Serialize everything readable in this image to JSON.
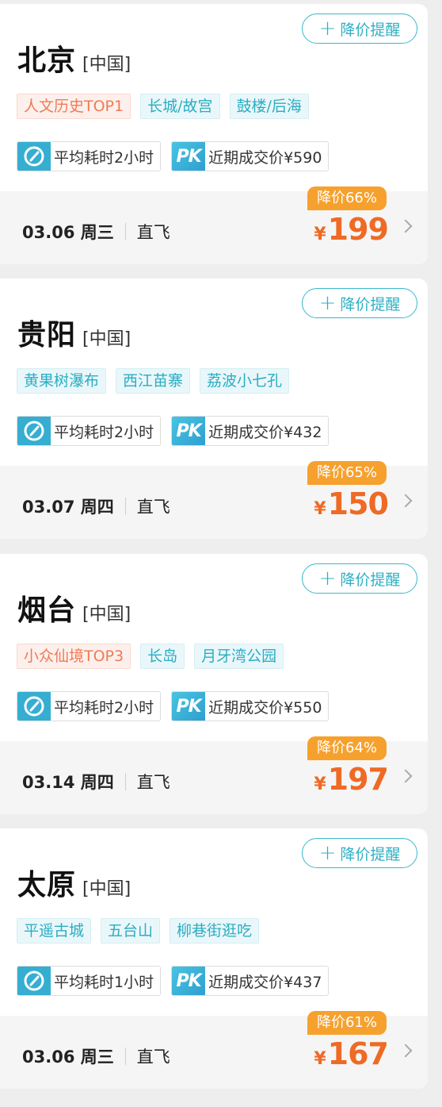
{
  "alert_label": "降价提醒",
  "cards": [
    {
      "city": "北京",
      "country": "[中国]",
      "tags": [
        {
          "label": "人文历史TOP1",
          "hot": true
        },
        {
          "label": "长城/故宫",
          "hot": false
        },
        {
          "label": "鼓楼/后海",
          "hot": false
        }
      ],
      "duration": "平均耗时2小时",
      "recent_price": "近期成交价¥590",
      "date": "03.06 周三",
      "flight_type": "直飞",
      "discount": "降价66%",
      "currency": "¥",
      "price": "199"
    },
    {
      "city": "贵阳",
      "country": "[中国]",
      "tags": [
        {
          "label": "黄果树瀑布",
          "hot": false
        },
        {
          "label": "西江苗寨",
          "hot": false
        },
        {
          "label": "荔波小七孔",
          "hot": false
        }
      ],
      "duration": "平均耗时2小时",
      "recent_price": "近期成交价¥432",
      "date": "03.07 周四",
      "flight_type": "直飞",
      "discount": "降价65%",
      "currency": "¥",
      "price": "150"
    },
    {
      "city": "烟台",
      "country": "[中国]",
      "tags": [
        {
          "label": "小众仙境TOP3",
          "hot": true
        },
        {
          "label": "长岛",
          "hot": false
        },
        {
          "label": "月牙湾公园",
          "hot": false
        }
      ],
      "duration": "平均耗时2小时",
      "recent_price": "近期成交价¥550",
      "date": "03.14 周四",
      "flight_type": "直飞",
      "discount": "降价64%",
      "currency": "¥",
      "price": "197"
    },
    {
      "city": "太原",
      "country": "[中国]",
      "tags": [
        {
          "label": "平遥古城",
          "hot": false
        },
        {
          "label": "五台山",
          "hot": false
        },
        {
          "label": "柳巷街逛吃",
          "hot": false
        }
      ],
      "duration": "平均耗时1小时",
      "recent_price": "近期成交价¥437",
      "date": "03.06 周三",
      "flight_type": "直飞",
      "discount": "降价61%",
      "currency": "¥",
      "price": "167"
    }
  ],
  "colors": {
    "accent": "#2fb0c4",
    "price": "#ee6a25",
    "discount_badge": "#f6a12e",
    "hot_tag": "#f07a55"
  },
  "icons": {
    "alert": "plus-icon",
    "duration": "timer-icon",
    "recent_price": "pk-icon",
    "arrow": "chevron-right-icon"
  }
}
